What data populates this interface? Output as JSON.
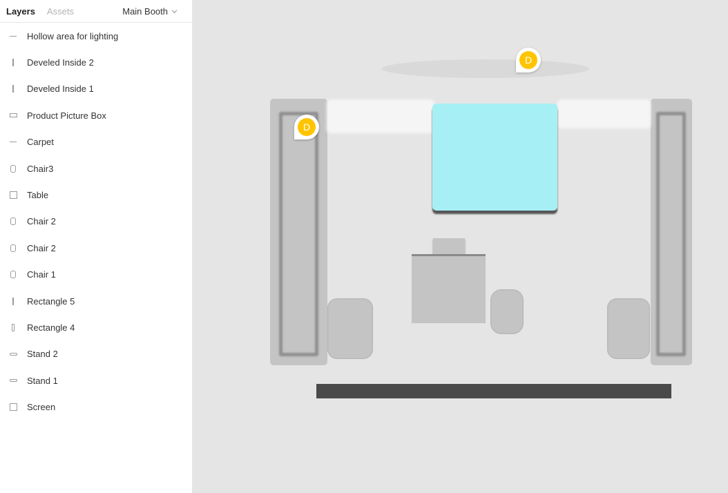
{
  "sidebar": {
    "tabs": {
      "layers": "Layers",
      "assets": "Assets"
    },
    "page": {
      "label": "Main Booth",
      "icon": "chevron-down-icon"
    },
    "layers": [
      {
        "label": "Hollow area for lighting",
        "icon": "line-horizontal-icon"
      },
      {
        "label": "Develed Inside 2",
        "icon": "line-vertical-icon"
      },
      {
        "label": "Develed Inside 1",
        "icon": "line-vertical-icon"
      },
      {
        "label": "Product Picture Box",
        "icon": "rectangle-wide-icon"
      },
      {
        "label": "Carpet",
        "icon": "line-horizontal-icon"
      },
      {
        "label": "Chair3",
        "icon": "rounded-rectangle-icon"
      },
      {
        "label": "Table",
        "icon": "square-icon"
      },
      {
        "label": "Chair 2",
        "icon": "rounded-rectangle-icon"
      },
      {
        "label": "Chair 2",
        "icon": "rounded-rectangle-icon"
      },
      {
        "label": "Chair 1",
        "icon": "rounded-rectangle-icon"
      },
      {
        "label": "Rectangle 5",
        "icon": "thin-rectangle-icon"
      },
      {
        "label": "Rectangle 4",
        "icon": "thin-rectangle-icon"
      },
      {
        "label": "Stand 2",
        "icon": "rounded-bar-icon"
      },
      {
        "label": "Stand 1",
        "icon": "rounded-bar-icon"
      },
      {
        "label": "Screen",
        "icon": "square-icon"
      }
    ]
  },
  "canvas": {
    "markers": [
      {
        "letter": "D"
      },
      {
        "letter": "D"
      }
    ],
    "colors": {
      "background": "#e5e5e5",
      "stand": "#c4c4c4",
      "picture_box": "#a6eff4",
      "screen": "#4a4a4a",
      "marker": "#ffc400"
    }
  }
}
